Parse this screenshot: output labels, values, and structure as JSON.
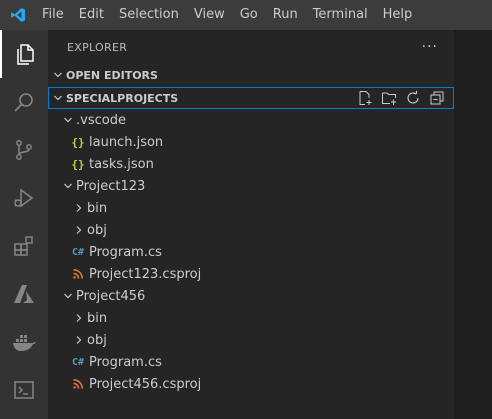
{
  "menu": [
    "File",
    "Edit",
    "Selection",
    "View",
    "Go",
    "Run",
    "Terminal",
    "Help"
  ],
  "explorer": {
    "title": "EXPLORER",
    "more_label": "···",
    "open_editors": "OPEN EDITORS",
    "workspace": "SPECIALPROJECTS"
  },
  "tree": {
    "vscode_folder": ".vscode",
    "launch_json": "launch.json",
    "tasks_json": "tasks.json",
    "project123": "Project123",
    "p123_bin": "bin",
    "p123_obj": "obj",
    "p123_program": "Program.cs",
    "p123_csproj": "Project123.csproj",
    "project456": "Project456",
    "p456_bin": "bin",
    "p456_obj": "obj",
    "p456_program": "Program.cs",
    "p456_csproj": "Project456.csproj"
  },
  "icons": {
    "json": "{}",
    "csharp": "C#",
    "rss": "rss-icon"
  },
  "colors": {
    "accent": "#007fd4",
    "json_icon": "#cbcb41",
    "csharp_icon": "#519aba",
    "csproj_icon": "#e37933"
  }
}
